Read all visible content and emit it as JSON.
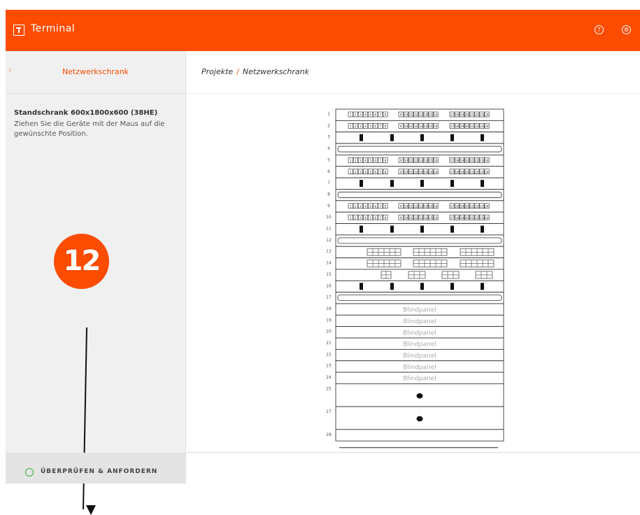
{
  "header": {
    "app_title": "Terminal",
    "icons": [
      "help-icon",
      "settings-icon"
    ],
    "accent": "#fc4c02"
  },
  "sidebar": {
    "back_icon": "chevron-left-icon",
    "title": "Netzwerkschrank",
    "rack_title": "Standschrank 600x1800x600 (38HE)",
    "instructions": "Ziehen Sie die Geräte mit der Maus auf die gewünschte Position.",
    "action_label": "ÜBERPRÜFEN & ANFORDERN"
  },
  "annotation": {
    "badge": "12"
  },
  "breadcrumb": {
    "parent": "Projekte",
    "separator": "/",
    "current": "Netzwerkschrank"
  },
  "rack": {
    "units": [
      {
        "n": "1",
        "type": "patch24"
      },
      {
        "n": "2",
        "type": "patch24"
      },
      {
        "n": "3",
        "type": "mgmt"
      },
      {
        "n": "4",
        "type": "blank-bar"
      },
      {
        "n": "5",
        "type": "patch24"
      },
      {
        "n": "6",
        "type": "patch24"
      },
      {
        "n": "7",
        "type": "mgmt"
      },
      {
        "n": "8",
        "type": "blank-bar"
      },
      {
        "n": "9",
        "type": "patch24"
      },
      {
        "n": "10",
        "type": "patch24"
      },
      {
        "n": "11",
        "type": "mgmt"
      },
      {
        "n": "12",
        "type": "blank-bar"
      },
      {
        "n": "13",
        "type": "switch-grid"
      },
      {
        "n": "14",
        "type": "switch-grid"
      },
      {
        "n": "15",
        "type": "switch-small"
      },
      {
        "n": "16",
        "type": "mgmt"
      },
      {
        "n": "17",
        "type": "blank-bar"
      },
      {
        "n": "18",
        "type": "blindpanel",
        "label": "Blindpanel"
      },
      {
        "n": "19",
        "type": "blindpanel",
        "label": "Blindpanel"
      },
      {
        "n": "20",
        "type": "blindpanel",
        "label": "Blindpanel"
      },
      {
        "n": "21",
        "type": "blindpanel",
        "label": "Blindpanel"
      },
      {
        "n": "22",
        "type": "blindpanel",
        "label": "Blindpanel"
      },
      {
        "n": "23",
        "type": "blindpanel",
        "label": "Blindpanel"
      },
      {
        "n": "24",
        "type": "blindpanel",
        "label": "Blindpanel"
      },
      {
        "n": "25",
        "type": "device-2u"
      },
      {
        "n": "27",
        "type": "device-2u"
      },
      {
        "n": "28",
        "type": "shelf"
      }
    ],
    "port_labels": [
      "1",
      "2",
      "3",
      "4",
      "5",
      "6",
      "7",
      "8",
      "9",
      "10",
      "11",
      "12",
      "13",
      "14",
      "15",
      "16",
      "17",
      "18",
      "19",
      "20",
      "21",
      "22",
      "23",
      "24"
    ]
  }
}
